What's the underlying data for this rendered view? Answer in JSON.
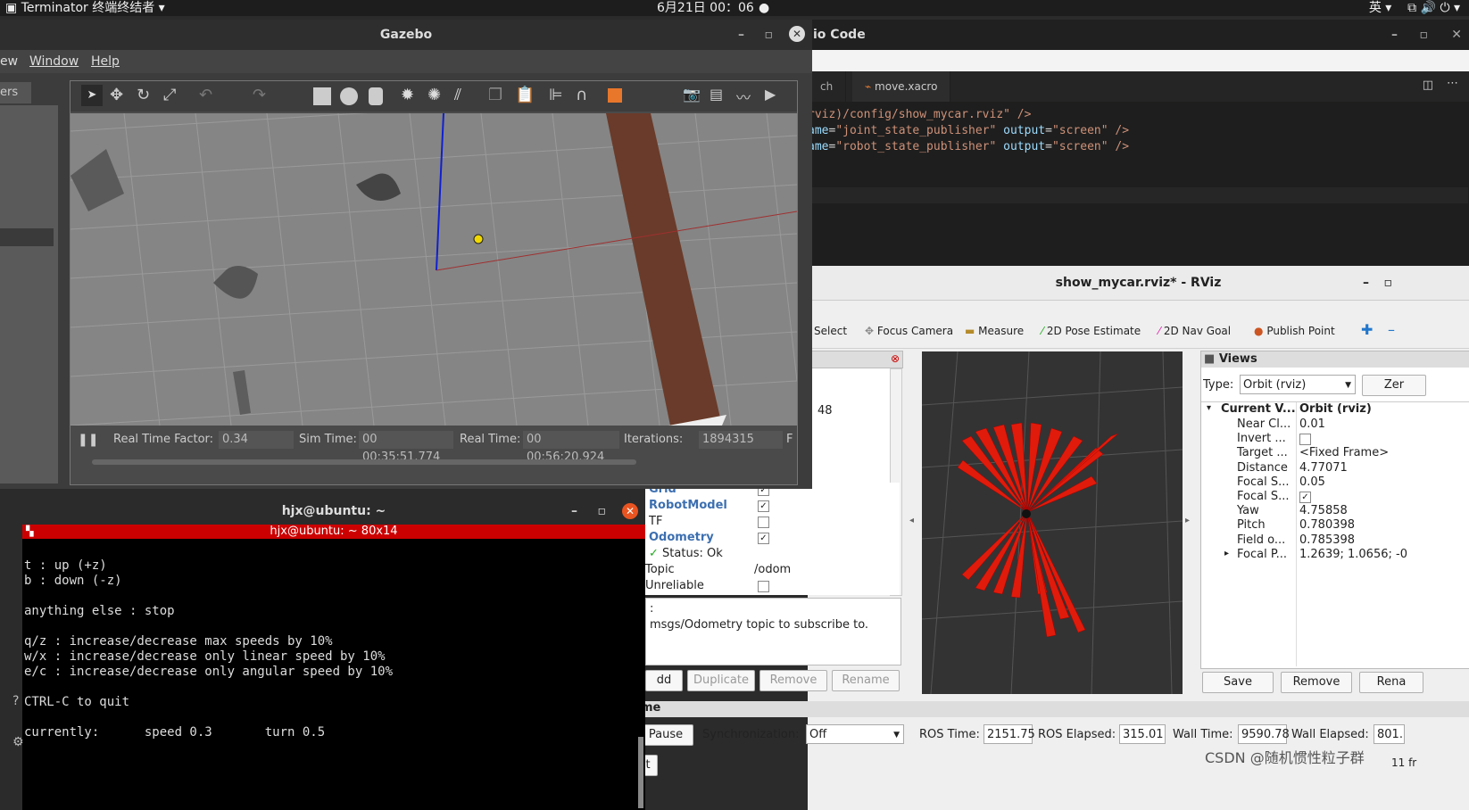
{
  "topbar": {
    "app_title": "Terminator 终端终结者",
    "clock": "6月21日 00：06",
    "input_method": "英"
  },
  "vscode": {
    "title": "io Code",
    "tabs": [
      "ch",
      "move.xacro"
    ],
    "code_lines": [
      {
        "attr": "",
        "value": "rviz)/config/show_mycar.rviz\" />"
      },
      {
        "attr": "ame",
        "value": "\"joint_state_publisher\"",
        "attr2": "output",
        "value2": "\"screen\" />"
      },
      {
        "attr": "ame",
        "value": "\"robot_state_publisher\"",
        "attr2": "output",
        "value2": "\"screen\" />"
      }
    ]
  },
  "gazebo": {
    "title": "Gazebo",
    "menu": [
      "ew",
      "Window",
      "Help"
    ],
    "side_tab": "ers",
    "real_time_factor_label": "Real Time Factor:",
    "real_time_factor": "0.34",
    "sim_time_label": "Sim Time:",
    "sim_time": "00 00:35:51.774",
    "real_time_label": "Real Time:",
    "real_time": "00 00:56:20.924",
    "iterations_label": "Iterations:",
    "iterations": "1894315",
    "trailing": "F"
  },
  "rviz": {
    "title": "show_mycar.rviz* - RViz",
    "tools": [
      "Select",
      "Focus Camera",
      "Measure",
      "2D Pose Estimate",
      "2D Nav Goal",
      "Publish Point"
    ],
    "displays": {
      "value48": "48",
      "items": [
        {
          "name": "Grid",
          "checked": "✓"
        },
        {
          "name": "RobotModel",
          "checked": "✓"
        },
        {
          "name": "TF",
          "checked": ""
        },
        {
          "name": "Odometry",
          "checked": "✓"
        }
      ],
      "status": "Status: Ok",
      "topic_label": "Topic",
      "topic_value": "/odom",
      "unreliable_label": "Unreliable",
      "desc_prefix": ":",
      "description": "msgs/Odometry topic to subscribe to."
    },
    "buttons": [
      "dd",
      "Duplicate",
      "Remove",
      "Rename"
    ],
    "views": {
      "header": "Views",
      "type_label": "Type:",
      "type_value": "Orbit (rviz)",
      "zero_button": "Zer",
      "current_view_label": "Current V...",
      "current_view_value": "Orbit (rviz)",
      "props": [
        {
          "name": "Near Cl...",
          "value": "0.01"
        },
        {
          "name": "Invert ...",
          "value": ""
        },
        {
          "name": "Target ...",
          "value": "<Fixed Frame>"
        },
        {
          "name": "Distance",
          "value": "4.77071"
        },
        {
          "name": "Focal S...",
          "value": "0.05"
        },
        {
          "name": "Focal S...",
          "value": "✓"
        },
        {
          "name": "Yaw",
          "value": "4.75858"
        },
        {
          "name": "Pitch",
          "value": "0.780398"
        },
        {
          "name": "Field o...",
          "value": "0.785398"
        },
        {
          "name": "Focal P...",
          "value": "1.2639; 1.0656; -0"
        }
      ],
      "save": "Save",
      "remove": "Remove",
      "rename": "Rena"
    },
    "time": {
      "header": "me",
      "pause": "Pause",
      "sync_label": "Synchronization:",
      "sync_value": "Off",
      "ros_time_label": "ROS Time:",
      "ros_time": "2151.75",
      "ros_elapsed_label": "ROS Elapsed:",
      "ros_elapsed": "315.01",
      "wall_time_label": "Wall Time:",
      "wall_time": "9590.78",
      "wall_elapsed_label": "Wall Elapsed:",
      "wall_elapsed": "801.",
      "fps": "11 fr",
      "reset": "t"
    }
  },
  "terminal": {
    "title": "hjx@ubuntu: ~",
    "bar": "hjx@ubuntu: ~ 80x14",
    "lines": [
      "t : up (+z)",
      "b : down (-z)",
      "",
      "anything else : stop",
      "",
      "q/z : increase/decrease max speeds by 10%",
      "w/x : increase/decrease only linear speed by 10%",
      "e/c : increase/decrease only angular speed by 10%",
      "",
      "CTRL-C to quit",
      "",
      "currently:\tspeed 0.3\tturn 0.5"
    ]
  },
  "watermark": "CSDN @随机惯性粒子群"
}
